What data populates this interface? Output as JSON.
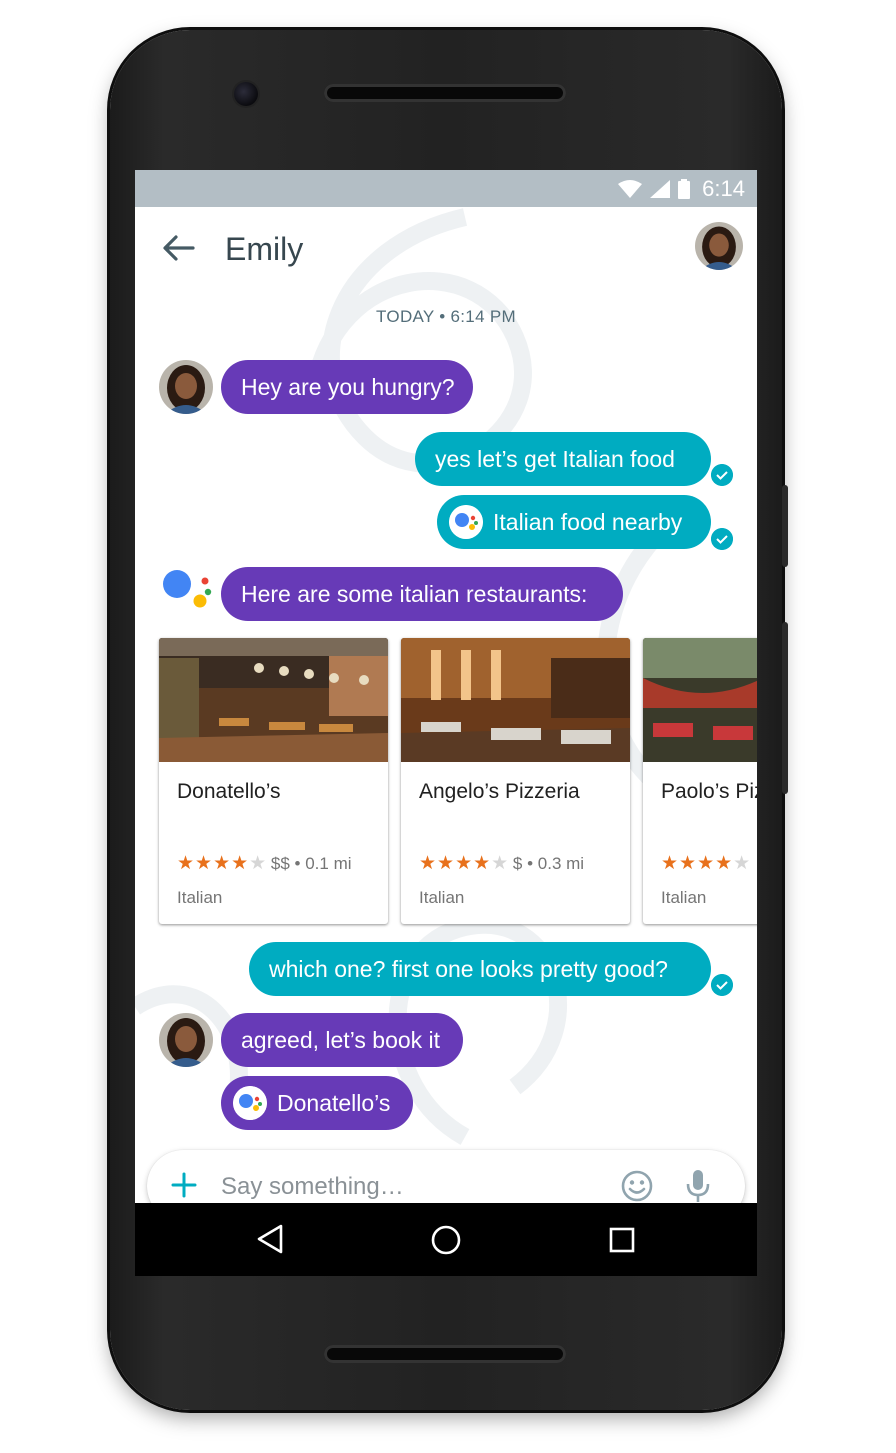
{
  "status_bar": {
    "time": "6:14"
  },
  "header": {
    "title": "Emily"
  },
  "timestamp": "TODAY • 6:14 PM",
  "messages": [
    {
      "text": "Hey are you hungry?"
    },
    {
      "text": "yes let’s get Italian food"
    },
    {
      "text": "Italian food nearby"
    },
    {
      "text": "Here are some italian restaurants:"
    },
    {
      "text": "which one? first one looks pretty good?"
    },
    {
      "text": "agreed, let’s book it"
    },
    {
      "text": "Donatello’s"
    }
  ],
  "restaurants": [
    {
      "name": "Donatello’s",
      "stars": "★★★★",
      "star_empty": "★",
      "meta": "$$ • 0.1 mi",
      "cuisine": "Italian",
      "rating": 4
    },
    {
      "name": "Angelo’s Pizzeria",
      "stars": "★★★★",
      "star_empty": "★",
      "meta": "$ • 0.3 mi",
      "cuisine": "Italian",
      "rating": 4
    },
    {
      "name": "Paolo’s Pizzeria",
      "stars": "★★★★",
      "star_empty": "★",
      "meta": "",
      "cuisine": "Italian",
      "rating": 4
    }
  ],
  "composer": {
    "placeholder": "Say something…"
  },
  "colors": {
    "purple": "#673ab7",
    "teal": "#00acc1",
    "status_bar": "#b3bec5",
    "star": "#e8711c"
  },
  "icons": [
    "back-arrow-icon",
    "wifi-icon",
    "signal-icon",
    "battery-icon",
    "check-icon",
    "google-assistant-icon",
    "plus-icon",
    "emoji-icon",
    "mic-icon",
    "nav-back-icon",
    "nav-home-icon",
    "nav-recents-icon"
  ]
}
